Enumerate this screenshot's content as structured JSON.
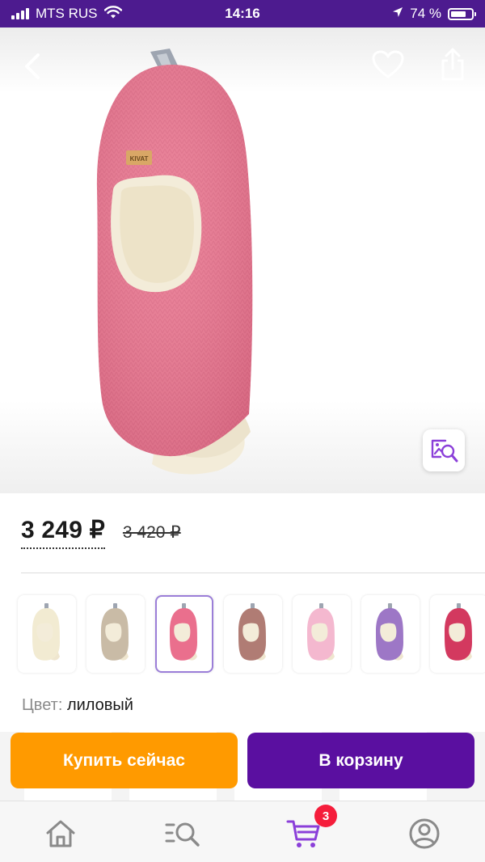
{
  "status_bar": {
    "carrier": "MTS RUS",
    "time": "14:16",
    "battery": "74 %",
    "battery_level": 0.74,
    "icons": [
      "signal-icon",
      "wifi-icon",
      "location-arrow-icon",
      "battery-icon"
    ]
  },
  "header": {
    "icons": [
      "back-arrow-icon",
      "heart-icon",
      "share-icon",
      "image-search-icon"
    ]
  },
  "product": {
    "image_desc_icon": "balaclava-hat",
    "main_color": "#e97790",
    "lining_color": "#f3ecd9",
    "label_text": "KIVAT"
  },
  "price": {
    "current": "3 249 ₽",
    "old": "3 420 ₽"
  },
  "variants": [
    {
      "color": "#f2ebd2",
      "selected": false
    },
    {
      "color": "#c9bba6",
      "selected": false
    },
    {
      "color": "#ea6f8d",
      "selected": true
    },
    {
      "color": "#b07c74",
      "selected": false
    },
    {
      "color": "#f4b8cf",
      "selected": false
    },
    {
      "color": "#9d77c6",
      "selected": false
    },
    {
      "color": "#d3395f",
      "selected": false
    }
  ],
  "color": {
    "label": "Цвет:",
    "value": "лиловый"
  },
  "actions": {
    "buy_now": "Купить сейчас",
    "add_to_cart": "В корзину",
    "buy_now_color": "#ff9a00",
    "add_to_cart_color": "#5a0fa0"
  },
  "tab_bar": {
    "tabs": [
      "home-icon",
      "catalog-search-icon",
      "cart-icon",
      "profile-icon"
    ],
    "cart_badge": "3",
    "accent": "#8b3fd9"
  }
}
